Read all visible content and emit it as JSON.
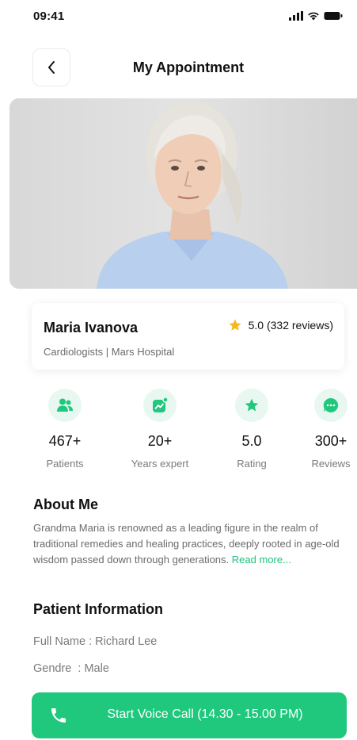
{
  "status_bar": {
    "time": "09:41",
    "icons": [
      "signal-icon",
      "wifi-icon",
      "battery-icon"
    ]
  },
  "header": {
    "back_icon": "chevron-left-icon",
    "title": "My Appointment"
  },
  "doctor": {
    "name": "Maria Ivanova",
    "specialty": "Cardiologists | Mars Hospital",
    "rating_text": "5.0 (332 reviews)",
    "rating_icon": "star-icon"
  },
  "stats": [
    {
      "icon": "patients-icon",
      "value": "467+",
      "label": "Patients"
    },
    {
      "icon": "chart-icon",
      "value": "20+",
      "label": "Years expert"
    },
    {
      "icon": "star-icon",
      "value": "5.0",
      "label": "Rating"
    },
    {
      "icon": "chat-icon",
      "value": "300+",
      "label": "Reviews"
    }
  ],
  "about": {
    "title": "About Me",
    "text": "Grandma Maria is renowned as a leading figure in the realm of traditional remedies and healing practices, deeply rooted in age-old wisdom passed down through generations.",
    "read_more": "Read more..."
  },
  "patient": {
    "title": "Patient Information",
    "full_name": "Full Name : Richard Lee",
    "gender": "Gendre  : Male"
  },
  "action": {
    "label": "Start Voice Call (14.30 - 15.00 PM)",
    "icon": "phone-icon"
  },
  "colors": {
    "accent": "#1fc87d",
    "accent_light": "#e9f7f1",
    "star": "#f5b91b"
  }
}
